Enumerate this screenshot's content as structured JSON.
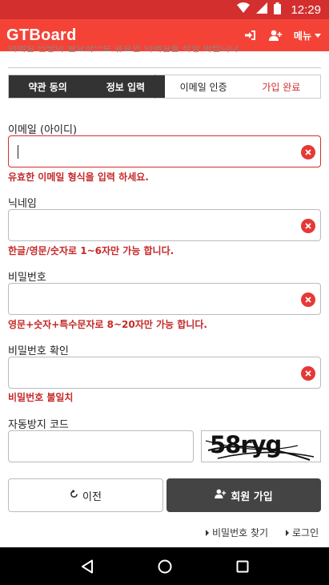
{
  "status_bar": {
    "time": "12:29"
  },
  "header": {
    "title": "GTBoard",
    "menu_label": "메뉴"
  },
  "intro_text": "이메일 인증이 필요하므로 유효한 이메일을 작성 바랍니다.",
  "steps": [
    {
      "label": "약관 동의"
    },
    {
      "label": "정보 입력"
    },
    {
      "label": "이메일 인증"
    },
    {
      "label": "가입 완료"
    }
  ],
  "form": {
    "email": {
      "label": "이메일 (아이디)",
      "value": "",
      "error": "유효한 이메일 형식을 입력 하세요."
    },
    "nickname": {
      "label": "닉네임",
      "value": "",
      "hint": "한글/영문/숫자로 1~6자만 가능 합니다."
    },
    "password": {
      "label": "비밀번호",
      "value": "",
      "hint": "영문+숫자+특수문자로 8~20자만 가능 합니다."
    },
    "password_confirm": {
      "label": "비밀번호 확인",
      "value": "",
      "error": "비밀번호 불일치"
    },
    "captcha": {
      "label": "자동방지 코드",
      "value": "",
      "image_text": "58ryg"
    }
  },
  "buttons": {
    "prev": "이전",
    "join": "회원 가입"
  },
  "links": {
    "find_password": "비밀번호 찾기",
    "login": "로그인"
  },
  "colors": {
    "brand": "#f44336",
    "status_bar": "#d32f2f",
    "error": "#c62828",
    "dark_button": "#444444"
  }
}
